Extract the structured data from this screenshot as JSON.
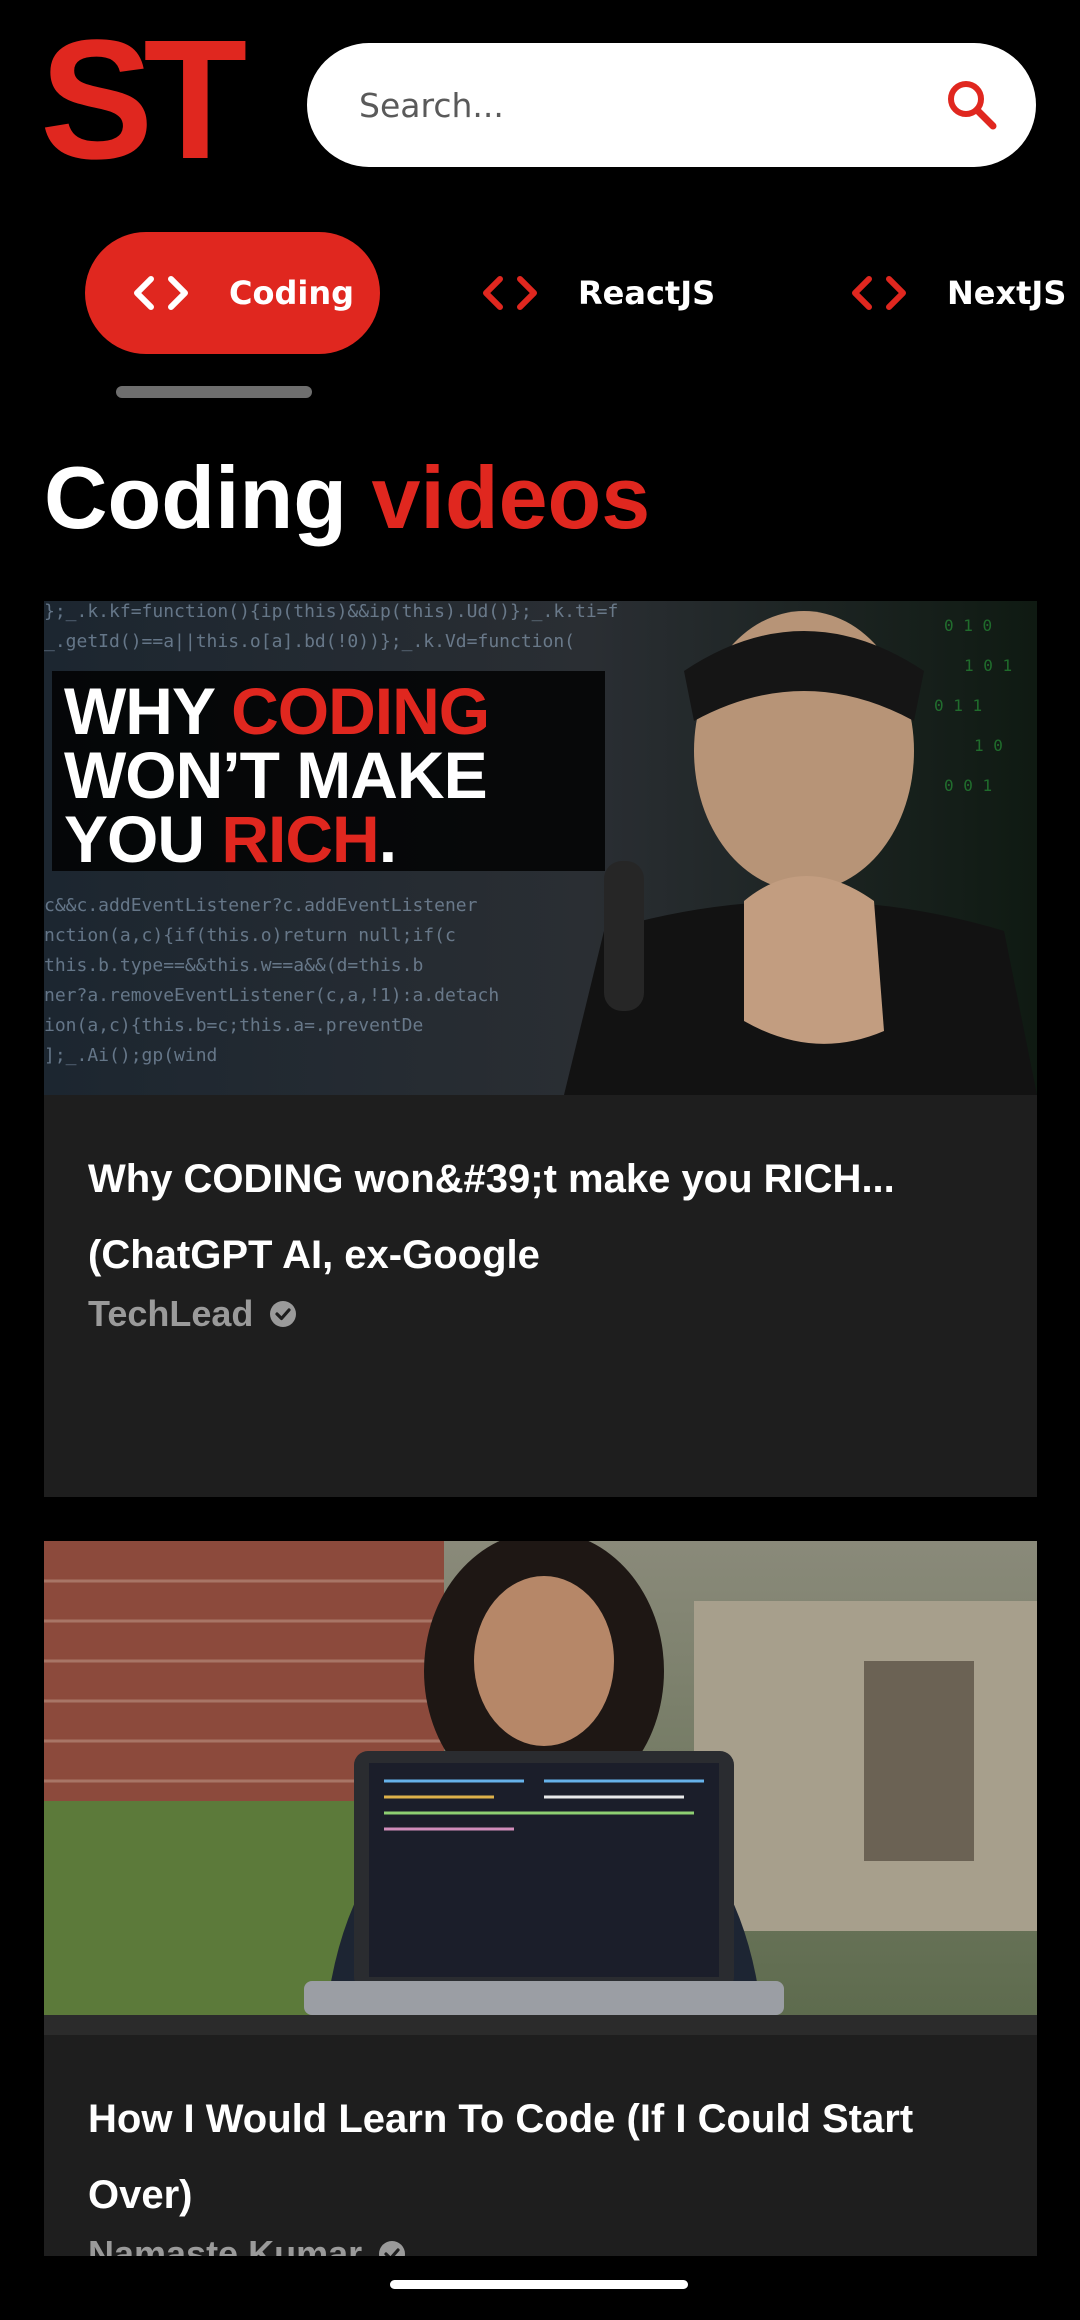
{
  "header": {
    "logo_text": "ST",
    "search_placeholder": "Search...",
    "search_icon": "search-icon"
  },
  "categories": [
    {
      "label": "Coding",
      "icon": "code-icon",
      "active": true
    },
    {
      "label": "ReactJS",
      "icon": "code-icon",
      "active": false
    },
    {
      "label": "NextJS",
      "icon": "code-icon",
      "active": false
    }
  ],
  "page_title": {
    "prefix": "Coding",
    "accent": "videos"
  },
  "videos": [
    {
      "thumbnail_text": {
        "line1_a": "WHY ",
        "line1_b": "CODING",
        "line2": "WON’T MAKE",
        "line3_a": "YOU ",
        "line3_b": "RICH",
        "line3_c": "."
      },
      "title": "Why CODING won&#39;t make you RICH... (ChatGPT AI, ex-Google",
      "channel": "TechLead",
      "verified": true
    },
    {
      "title": "How I Would Learn To Code (If I Could Start Over)",
      "channel": "Namaste Kumar",
      "verified": true
    }
  ],
  "colors": {
    "accent": "#e0271f",
    "background": "#000000",
    "card": "#1e1e1e",
    "muted": "#9a9a9a"
  }
}
